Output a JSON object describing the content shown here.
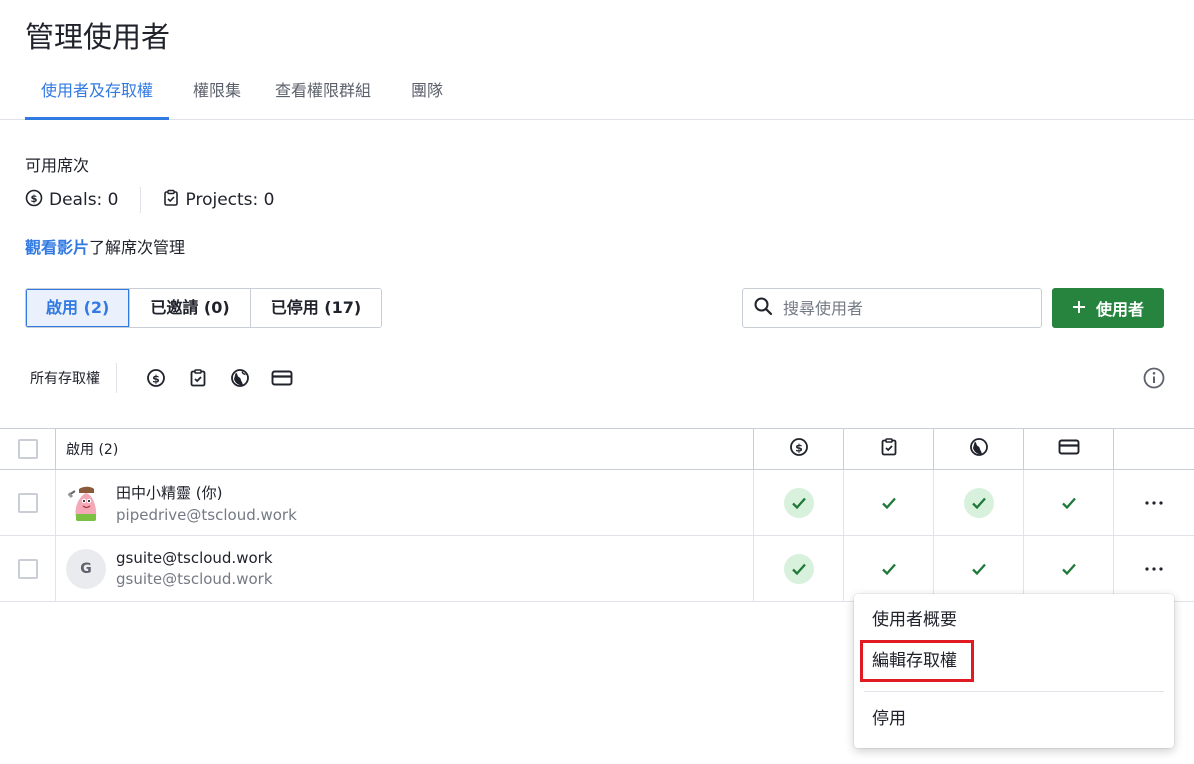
{
  "page": {
    "title": "管理使用者"
  },
  "tabs": [
    {
      "label": "使用者及存取權",
      "active": true
    },
    {
      "label": "權限集"
    },
    {
      "label": "查看權限群組"
    },
    {
      "label": "團隊"
    }
  ],
  "seats": {
    "label": "可用席次",
    "deals": "Deals: 0",
    "projects": "Projects: 0",
    "video_link": "觀看影片",
    "video_suffix": "了解席次管理"
  },
  "segments": [
    {
      "label": "啟用 (2)",
      "active": true
    },
    {
      "label": "已邀請 (0)"
    },
    {
      "label": "已停用 (17)"
    }
  ],
  "search": {
    "placeholder": "搜尋使用者"
  },
  "add_button": {
    "label": "使用者"
  },
  "filter": {
    "label": "所有存取權"
  },
  "table": {
    "header_label": "啟用 (2)",
    "rows": [
      {
        "name": "田中小精靈 (你)",
        "email": "pipedrive@tscloud.work",
        "avatar": "patrick-avatar"
      },
      {
        "name": "gsuite@tscloud.work",
        "email": "gsuite@tscloud.work",
        "avatar_letter": "G"
      }
    ]
  },
  "context_menu": {
    "items": [
      "使用者概要",
      "編輯存取權",
      "停用"
    ],
    "highlighted": "編輯存取權"
  },
  "colors": {
    "accent": "#317ae2",
    "primary_button": "#26843f",
    "check_green": "#1f7a3a",
    "highlight": "#e11b22"
  },
  "icons": [
    "deals-dollar-icon",
    "projects-clipboard-icon",
    "globe-icon",
    "card-icon",
    "info-icon",
    "search-icon",
    "plus-icon",
    "more-icon",
    "check-icon"
  ]
}
